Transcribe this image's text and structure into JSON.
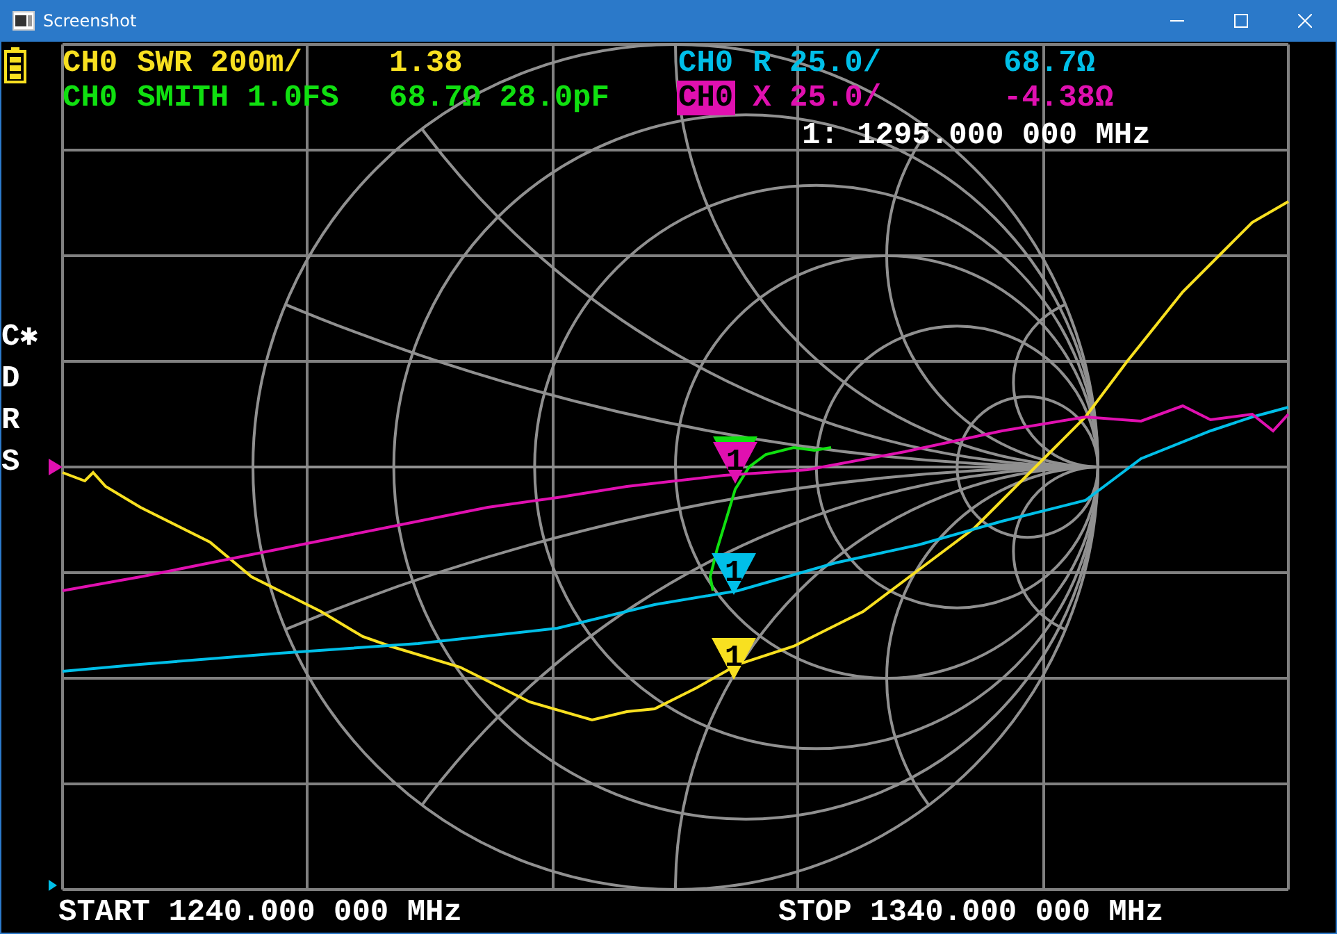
{
  "window": {
    "title": "Screenshot"
  },
  "traces": [
    {
      "channel": "CH0",
      "label": "SWR 200m/",
      "value": "1.38",
      "color": "#f8e020",
      "selected": false
    },
    {
      "channel": "CH0",
      "label": "R 25.0/",
      "value": "68.7Ω",
      "color": "#00bfe8",
      "selected": false
    },
    {
      "channel": "CH0",
      "label": "SMITH 1.0FS",
      "value": "68.7Ω 28.0pF",
      "color": "#10e010",
      "selected": false
    },
    {
      "channel": "CH0",
      "label": "X 25.0/",
      "value": "-4.38Ω",
      "color": "#e010b0",
      "selected": true
    }
  ],
  "markers": [
    {
      "color": "#10e010"
    },
    {
      "label": "1",
      "color": "#e010b0"
    },
    {
      "label": "1",
      "color": "#00bfe8"
    },
    {
      "label": "1",
      "color": "#f8e020"
    }
  ],
  "marker_readout": "1: 1295.000 000 MHz",
  "side_letters": [
    "C✱",
    "D",
    "R",
    "S"
  ],
  "start": "START 1240.000 000 MHz",
  "stop": "STOP 1340.000 000 MHz"
}
